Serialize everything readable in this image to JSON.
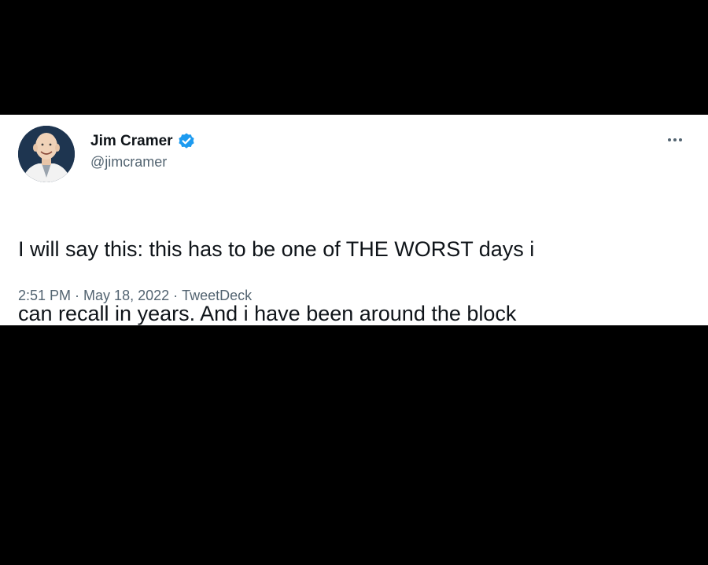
{
  "tweet": {
    "display_name": "Jim Cramer",
    "handle": "@jimcramer",
    "verified": true,
    "text_line1": "I will say this: this has to be one of THE WORST days i",
    "text_line2": "can recall in years. And i have been around the block",
    "time": "2:51 PM",
    "date": "May 18, 2022",
    "source": "TweetDeck",
    "separator": "·"
  },
  "icons": {
    "verified": "verified-badge-icon",
    "more": "more-options-icon"
  },
  "colors": {
    "background": "#000000",
    "card": "#ffffff",
    "text": "#0f1419",
    "secondary_text": "#536471",
    "verified_blue": "#1d9bf0"
  }
}
